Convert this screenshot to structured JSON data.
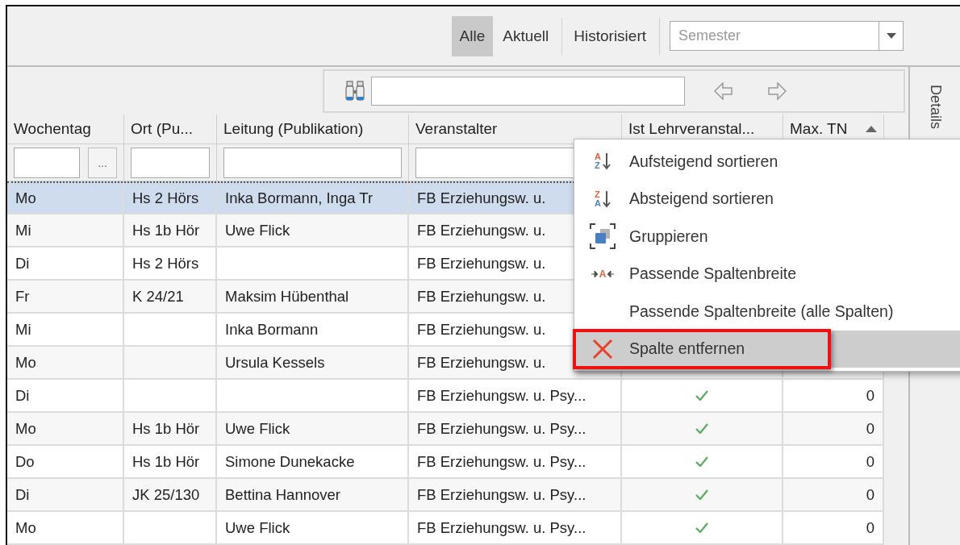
{
  "toolbar": {
    "filters": [
      {
        "label": "Alle",
        "selected": true
      },
      {
        "label": "Aktuell",
        "selected": false
      },
      {
        "label": "Historisiert",
        "selected": false
      }
    ],
    "semester": {
      "placeholder": "Semester"
    }
  },
  "details_tab": {
    "label": "Details"
  },
  "table": {
    "columns": [
      {
        "label": "Wochentag",
        "sorted": false,
        "filter_button": "..."
      },
      {
        "label": "Ort (Pu...",
        "sorted": false
      },
      {
        "label": "Leitung (Publikation)",
        "sorted": false
      },
      {
        "label": "Veranstalter",
        "sorted": false
      },
      {
        "label": "Ist Lehrveranstal...",
        "sorted": false
      },
      {
        "label": "Max. TN",
        "sorted": true
      }
    ],
    "rows": [
      {
        "selected": true,
        "cells": [
          "Mo",
          "Hs 2 Hörs",
          "Inka Bormann, Inga Tr",
          "FB Erziehungsw. u."
        ]
      },
      {
        "selected": false,
        "cells": [
          "Mi",
          "Hs 1b Hör",
          "Uwe Flick",
          "FB Erziehungsw. u."
        ]
      },
      {
        "selected": false,
        "cells": [
          "Di",
          "Hs 2 Hörs",
          null,
          "FB Erziehungsw. u."
        ]
      },
      {
        "selected": false,
        "cells": [
          "Fr",
          "K 24/21",
          "Maksim Hübenthal",
          "FB Erziehungsw. u."
        ]
      },
      {
        "selected": false,
        "cells": [
          "Mi",
          null,
          "Inka Bormann",
          "FB Erziehungsw. u."
        ]
      },
      {
        "selected": false,
        "cells": [
          "Mo",
          null,
          "Ursula Kessels",
          "FB Erziehungsw. u."
        ]
      },
      {
        "selected": false,
        "cells": [
          "Di",
          null,
          null,
          "FB Erziehungsw. u. Psy..."
        ],
        "is_course": true,
        "max_tn": "0"
      },
      {
        "selected": false,
        "cells": [
          "Mo",
          "Hs 1b Hör",
          "Uwe Flick",
          "FB Erziehungsw. u. Psy..."
        ],
        "is_course": true,
        "max_tn": "0"
      },
      {
        "selected": false,
        "cells": [
          "Do",
          "Hs 1b Hör",
          "Simone Dunekacke",
          "FB Erziehungsw. u. Psy..."
        ],
        "is_course": true,
        "max_tn": "0"
      },
      {
        "selected": false,
        "cells": [
          "Di",
          "JK 25/130",
          "Bettina Hannover",
          "FB Erziehungsw. u. Psy..."
        ],
        "is_course": true,
        "max_tn": "0"
      },
      {
        "selected": false,
        "cells": [
          "Mo",
          null,
          "Uwe Flick",
          "FB Erziehungsw. u. Psy..."
        ],
        "is_course": true,
        "max_tn": "0"
      }
    ]
  },
  "context_menu": {
    "items": [
      {
        "kind": "sort-asc",
        "label": "Aufsteigend sortieren",
        "icon_letters": [
          "A",
          "Z"
        ],
        "highlighted": false,
        "framed": false
      },
      {
        "kind": "sort-desc",
        "label": "Absteigend sortieren",
        "icon_letters": [
          "Z",
          "A"
        ],
        "highlighted": false,
        "framed": false
      },
      {
        "kind": "group",
        "label": "Gruppieren",
        "highlighted": false,
        "framed": false
      },
      {
        "kind": "fit",
        "label": "Passende Spaltenbreite",
        "icon_letters": [
          "A"
        ],
        "highlighted": false,
        "framed": false
      },
      {
        "kind": "none",
        "label": "Passende Spaltenbreite (alle Spalten)",
        "highlighted": false,
        "framed": false
      },
      {
        "kind": "remove",
        "label": "Spalte entfernen",
        "highlighted": true,
        "framed": true
      }
    ]
  }
}
